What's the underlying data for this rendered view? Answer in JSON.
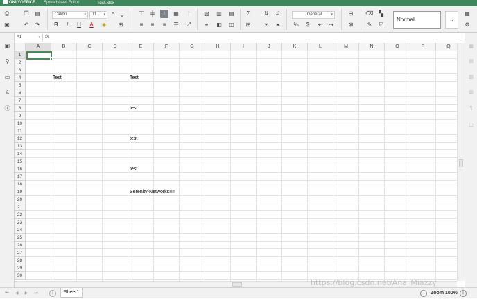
{
  "app": {
    "brand": "ONLYOFFICE",
    "subtitle": "Spreadsheet Editor",
    "filename": "Test.xlsx"
  },
  "toolbar": {
    "font_name": "Calibri",
    "font_size": "11",
    "number_format": "General",
    "style_preset": "Normal",
    "buttons": {
      "bold": "B",
      "italic": "I",
      "underline": "U",
      "font_color": "A"
    }
  },
  "formula_bar": {
    "cell_ref": "A1",
    "fx": "fx",
    "content": ""
  },
  "grid": {
    "columns": [
      "A",
      "B",
      "C",
      "D",
      "E",
      "F",
      "G",
      "H",
      "I",
      "J",
      "K",
      "L",
      "M",
      "N",
      "O",
      "P",
      "Q"
    ],
    "rows": [
      "1",
      "2",
      "3",
      "4",
      "5",
      "6",
      "7",
      "8",
      "9",
      "10",
      "11",
      "12",
      "13",
      "14",
      "15",
      "16",
      "17",
      "18",
      "19",
      "20",
      "21",
      "22",
      "23",
      "24",
      "25",
      "26",
      "27",
      "28",
      "29",
      "30"
    ],
    "selected_cell": "A1",
    "cells": [
      {
        "ref": "B4",
        "value": "Test"
      },
      {
        "ref": "E4",
        "value": "Test"
      },
      {
        "ref": "E8",
        "value": "test"
      },
      {
        "ref": "E12",
        "value": "test"
      },
      {
        "ref": "E16",
        "value": "test"
      },
      {
        "ref": "E19",
        "value": "Serenity-Networks!!!!"
      }
    ]
  },
  "statusbar": {
    "sheets": [
      "Sheet1"
    ],
    "zoom": "Zoom 100%"
  },
  "watermark": "https://blog.csdn.net/Ana_Miazzy"
}
